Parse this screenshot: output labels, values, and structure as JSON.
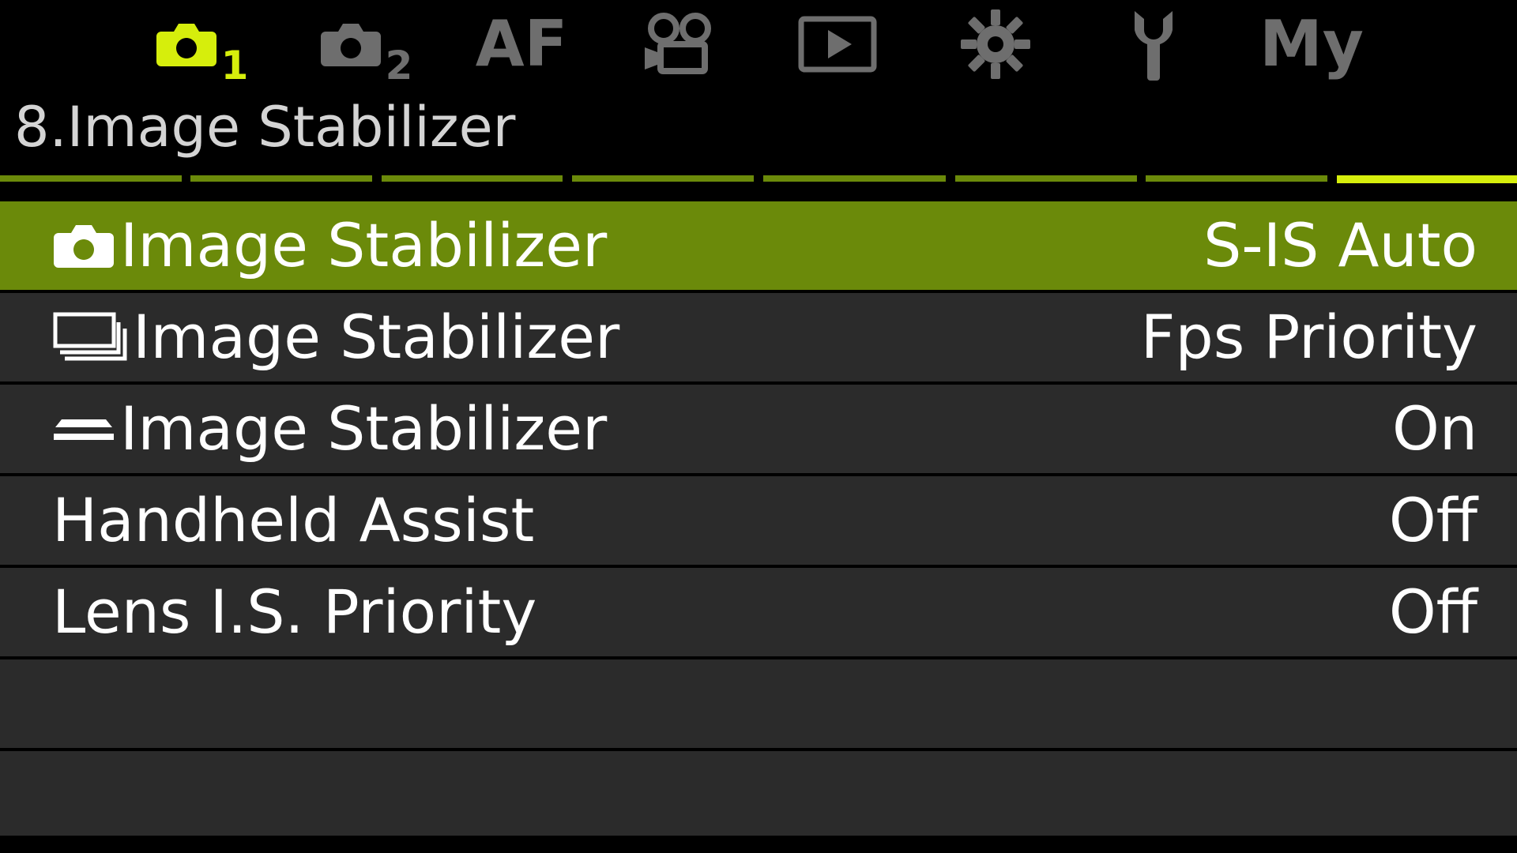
{
  "colors": {
    "accent": "#d6ee0c",
    "selected_row": "#6b8a0a",
    "row_bg": "#2b2b2b",
    "inactive_tab": "#6e6e6e"
  },
  "tabs": [
    {
      "id": "shooting1",
      "icon": "camera-icon",
      "sub": "1",
      "active": true
    },
    {
      "id": "shooting2",
      "icon": "camera-icon",
      "sub": "2",
      "active": false
    },
    {
      "id": "af",
      "text": "AF",
      "active": false
    },
    {
      "id": "video",
      "icon": "movie-camera-icon",
      "active": false
    },
    {
      "id": "playback",
      "icon": "play-icon",
      "active": false
    },
    {
      "id": "custom",
      "icon": "gear-icon",
      "active": false
    },
    {
      "id": "setup",
      "icon": "wrench-icon",
      "active": false
    },
    {
      "id": "mymenu",
      "text": "My",
      "active": false
    }
  ],
  "page": {
    "title": "8.Image Stabilizer",
    "page_count": 8,
    "current_page": 8
  },
  "menu": {
    "items": [
      {
        "icon": "camera-icon",
        "label": "Image Stabilizer",
        "value": "S-IS Auto",
        "selected": true
      },
      {
        "icon": "sequential-shooting-icon",
        "label": "Image Stabilizer",
        "value": "Fps Priority",
        "selected": false
      },
      {
        "icon": "half-press-icon",
        "label": "Image Stabilizer",
        "value": "On",
        "selected": false
      },
      {
        "icon": "",
        "label": "Handheld Assist",
        "value": "Off",
        "selected": false
      },
      {
        "icon": "",
        "label": "Lens I.S. Priority",
        "value": "Off",
        "selected": false
      }
    ],
    "empty_rows": 2
  }
}
